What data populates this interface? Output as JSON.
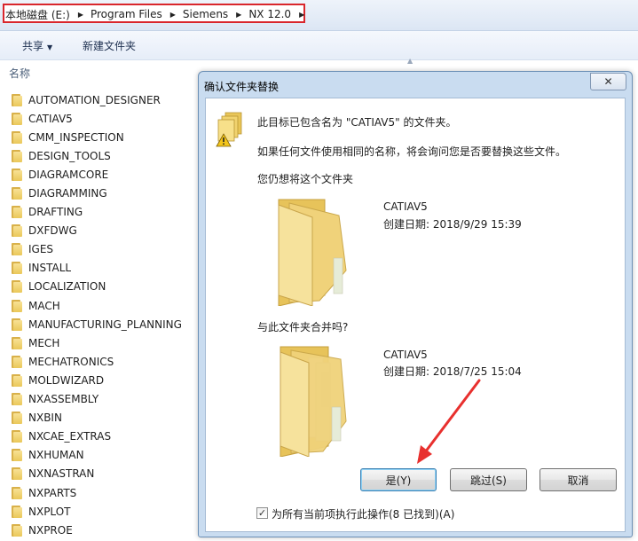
{
  "address_bar": {
    "crumbs": [
      "本地磁盘 (E:)",
      "Program Files",
      "Siemens",
      "NX 12.0"
    ]
  },
  "toolbar": {
    "share_label": "共享",
    "new_folder_label": "新建文件夹"
  },
  "file_list": {
    "column_header": "名称",
    "items": [
      "AUTOMATION_DESIGNER",
      "CATIAV5",
      "CMM_INSPECTION",
      "DESIGN_TOOLS",
      "DIAGRAMCORE",
      "DIAGRAMMING",
      "DRAFTING",
      "DXFDWG",
      "IGES",
      "INSTALL",
      "LOCALIZATION",
      "MACH",
      "MANUFACTURING_PLANNING",
      "MECH",
      "MECHATRONICS",
      "MOLDWIZARD",
      "NXASSEMBLY",
      "NXBIN",
      "NXCAE_EXTRAS",
      "NXHUMAN",
      "NXNASTRAN",
      "NXPARTS",
      "NXPLOT",
      "NXPROE"
    ]
  },
  "dialog": {
    "title": "确认文件夹替换",
    "message_1": "此目标已包含名为 \"CATIAV5\" 的文件夹。",
    "message_2": "如果任何文件使用相同的名称，将会询问您是否要替换这些文件。",
    "prompt_keep": "您仍想将这个文件夹",
    "existing": {
      "name": "CATIAV5",
      "created": "创建日期: 2018/9/29 15:39"
    },
    "prompt_merge": "与此文件夹合并吗?",
    "incoming": {
      "name": "CATIAV5",
      "created": "创建日期: 2018/7/25 15:04"
    },
    "buttons": {
      "yes": "是(Y)",
      "skip": "跳过(S)",
      "cancel": "取消"
    },
    "apply_all": {
      "checked": true,
      "label": "为所有当前项执行此操作(8 已找到)(A)"
    }
  },
  "colors": {
    "highlight_box": "#d9262c",
    "annotation_arrow": "#e8302e",
    "folder": "#f0cf6a"
  }
}
